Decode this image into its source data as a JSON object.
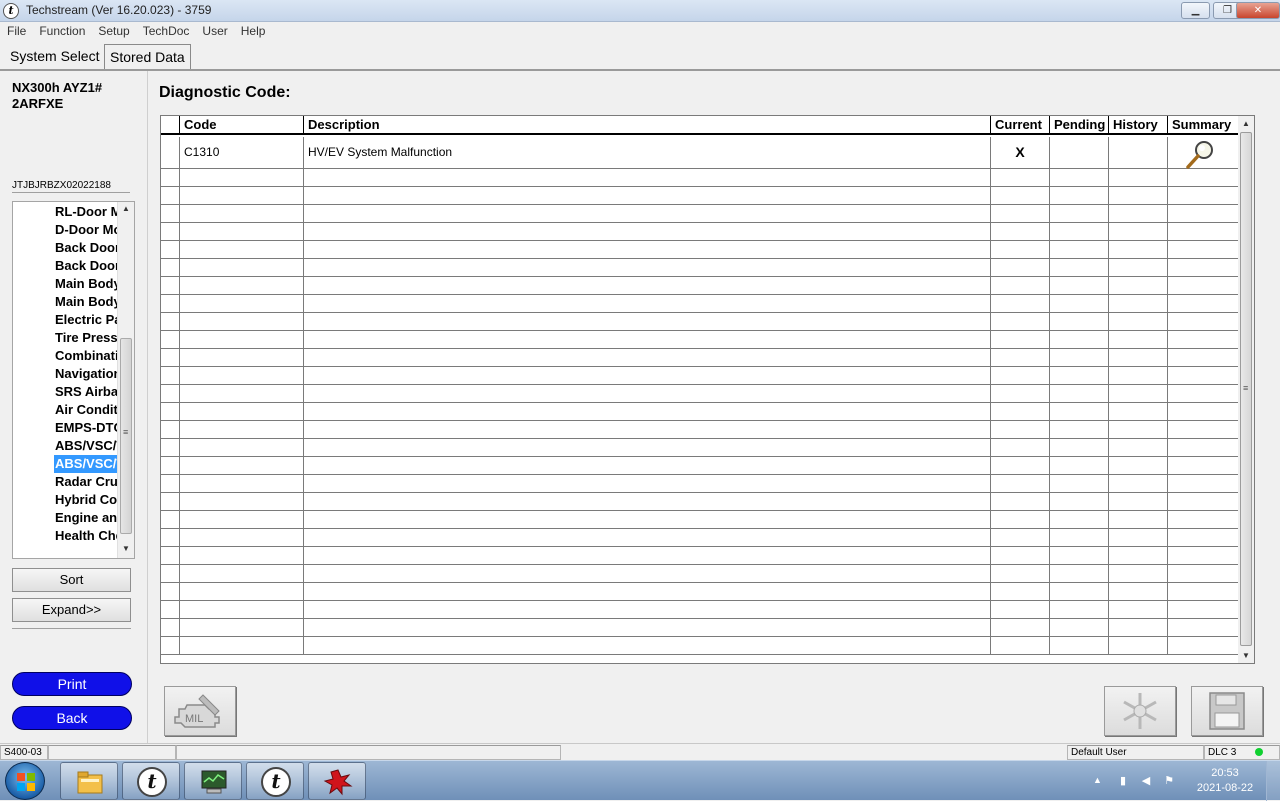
{
  "window": {
    "title": "Techstream (Ver 16.20.023) - 3759"
  },
  "menu": [
    "File",
    "Function",
    "Setup",
    "TechDoc",
    "User",
    "Help"
  ],
  "tabs": [
    {
      "label": "System Select",
      "active": false
    },
    {
      "label": "Stored Data",
      "active": true
    }
  ],
  "vehicle": {
    "line1": "NX300h AYZ1#",
    "line2": "2ARFXE",
    "vin": "JTJBJRBZX02022188"
  },
  "systems": [
    "RL-Door Motor",
    "D-Door Motor",
    "Back Door Motor",
    "Back Door Closer",
    "Main Body",
    "Main Body ECU",
    "Electric Parking Brake",
    "Tire Pressure Monitor",
    "Combination Meter",
    "Navigation System",
    "SRS Airbag",
    "Air Conditioner",
    "EMPS-DTC",
    "ABS/VSC/TRC",
    "ABS/VSC/TRC",
    "Radar Cruise",
    "Hybrid Control",
    "Engine and ECT",
    "Health Check"
  ],
  "selected_system_index": 14,
  "left_buttons": {
    "sort": "Sort",
    "expand": "Expand>>",
    "print": "Print",
    "back": "Back"
  },
  "main": {
    "title": "Diagnostic Code:",
    "columns": [
      "Code",
      "Description",
      "Current",
      "Pending",
      "History",
      "Summary"
    ],
    "rows": [
      {
        "code": "C1310",
        "description": "HV/EV System Malfunction",
        "current": "X",
        "pending": "",
        "history": "",
        "summary": "magnifier-icon"
      }
    ],
    "empty_rows": 27
  },
  "status": {
    "screen_id": "S400-03",
    "user": "Default User",
    "dlc": "DLC 3",
    "dlc_color": "#10d030"
  },
  "taskbar": {
    "time": "20:53",
    "date": "2021-08-22",
    "apps": [
      "file-explorer-icon",
      "techstream-icon",
      "monitor-app-icon",
      "techstream-icon",
      "red-splat-app-icon"
    ]
  }
}
